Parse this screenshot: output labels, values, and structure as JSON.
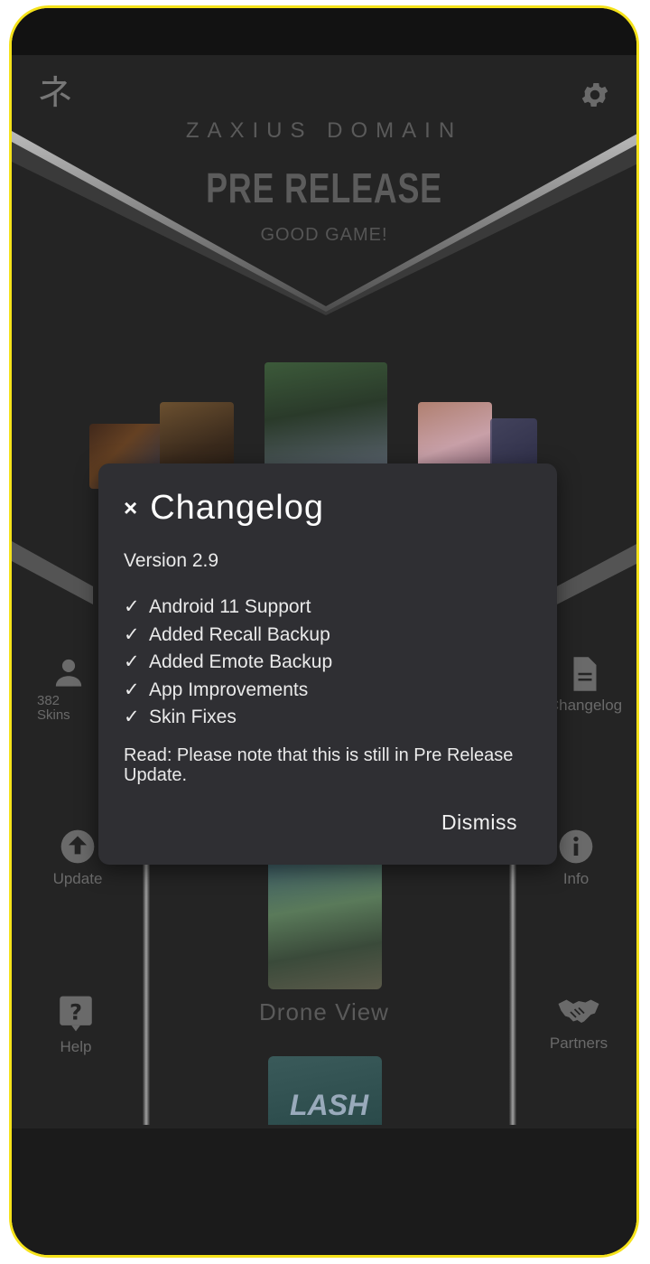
{
  "header": {
    "logo_glyph": "ネ",
    "brand": "ZAXIUS DOMAIN",
    "title": "PRE RELEASE",
    "subtitle": "GOOD GAME!"
  },
  "side_menu": {
    "skins_count": "382",
    "skins_label": "Skins",
    "changelog": "Changelog",
    "update": "Update",
    "info": "Info",
    "help": "Help",
    "partners": "Partners"
  },
  "main": {
    "drone_view_label": "Drone View",
    "thumb_text": "LASH"
  },
  "dialog": {
    "close_glyph": "×",
    "title": "Changelog",
    "version": "Version 2.9",
    "items": [
      "Android 11 Support",
      "Added Recall Backup",
      "Added Emote Backup",
      "App Improvements",
      "Skin Fixes"
    ],
    "check_glyph": "✓",
    "note": "Read: Please note that this is still in Pre Release Update.",
    "dismiss_label": "Dismiss"
  },
  "colors": {
    "frame": "#f5e21a",
    "background": "#242424",
    "dialog": "#2f2f33"
  }
}
